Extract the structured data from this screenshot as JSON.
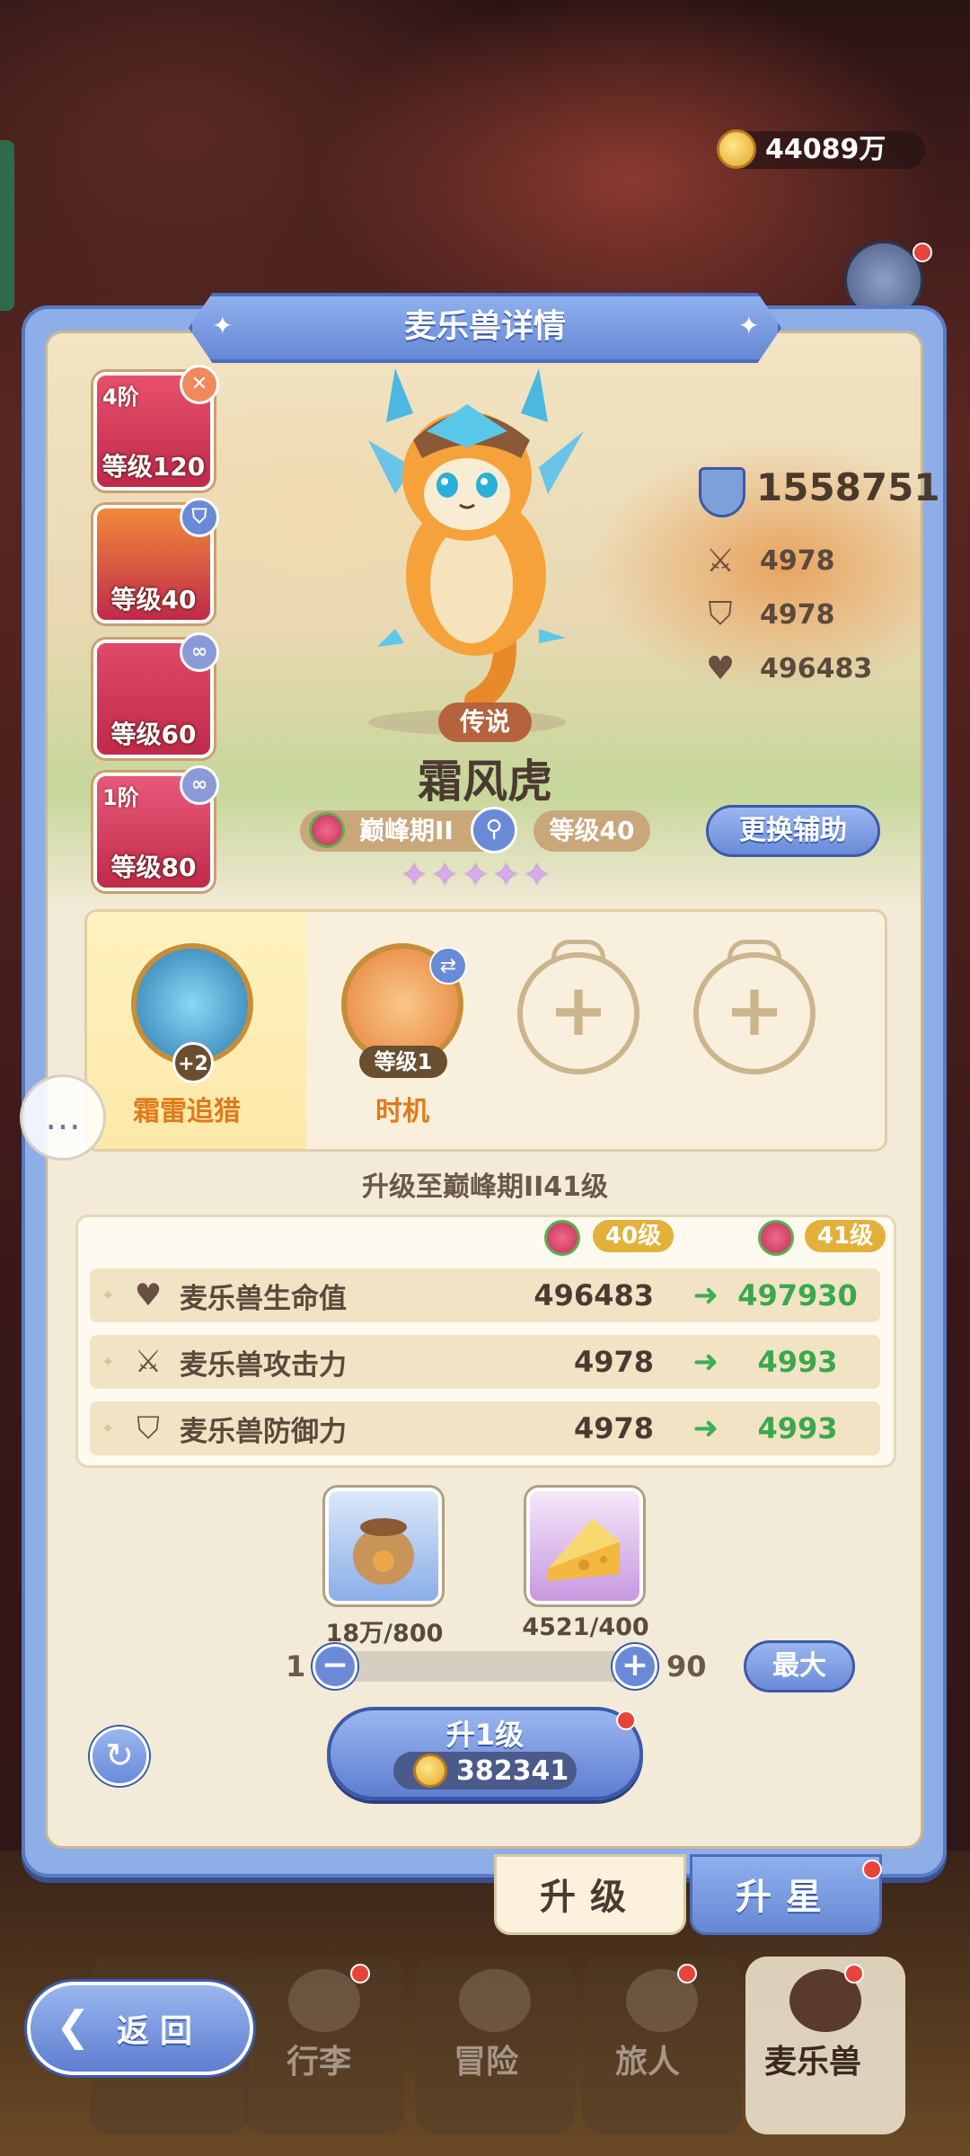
{
  "currency": {
    "coins": "44089万"
  },
  "title": "麦乐兽详情",
  "helpers": [
    {
      "tier": "4阶",
      "level": "等级120",
      "color": "#e8506a",
      "badge_color": "#f08a5a",
      "badge": "✕"
    },
    {
      "tier": "",
      "level": "等级40",
      "color": "#f08a3a",
      "badge_color": "#6a8ad8",
      "badge": "⛉"
    },
    {
      "tier": "",
      "level": "等级60",
      "color": "#e04a6a",
      "badge_color": "#8a9ad8",
      "badge": "∞"
    },
    {
      "tier": "1阶",
      "level": "等级80",
      "color": "#e85a7a",
      "badge_color": "#8a9ad8",
      "badge": "∞"
    }
  ],
  "pet": {
    "rarity": "传说",
    "name": "霜风虎",
    "stage": "巅峰期II",
    "level": "等级40",
    "stars": 5,
    "swap_helper_label": "更换辅助"
  },
  "stats": {
    "power": "1558751",
    "attack": "4978",
    "defense": "4978",
    "hp": "496483"
  },
  "skills": [
    {
      "name": "霜雷追猎",
      "badge": "+2"
    },
    {
      "name": "时机",
      "badge": "等级1"
    }
  ],
  "upgrade": {
    "title": "升级至巅峰期II41级",
    "from_level": "40级",
    "to_level": "41级",
    "rows": [
      {
        "label": "麦乐兽生命值",
        "icon": "heart-icon",
        "current": "496483",
        "next": "497930"
      },
      {
        "label": "麦乐兽攻击力",
        "icon": "swords-icon",
        "current": "4978",
        "next": "4993"
      },
      {
        "label": "麦乐兽防御力",
        "icon": "shield-icon",
        "current": "4978",
        "next": "4993"
      }
    ]
  },
  "materials": [
    {
      "name": "food-bag",
      "count": "18万/800"
    },
    {
      "name": "cheese",
      "count": "4521/400"
    }
  ],
  "slider": {
    "min": "1",
    "max": "90",
    "max_button": "最大",
    "value_fraction": 1.0
  },
  "level_up_button": {
    "label": "升1级",
    "cost": "382341"
  },
  "tabs": {
    "upgrade": "升级",
    "star": "升星"
  },
  "nav": {
    "back": "返回",
    "items": [
      "行李",
      "冒险",
      "旅人",
      "麦乐兽"
    ]
  },
  "colors": {
    "accent_blue": "#6a8ad8",
    "stat_green": "#3aa84c",
    "level_badge": "#e3b03a"
  }
}
